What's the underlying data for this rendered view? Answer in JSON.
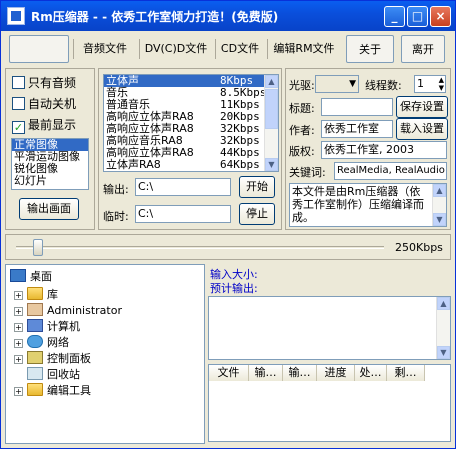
{
  "window": {
    "title": "Rm压缩器 - - 依秀工作室倾力打造！(免费版)",
    "min": "_",
    "max": "□",
    "close": "×"
  },
  "toolbar": {
    "audio": "音频文件",
    "dvd": "DV(C)D文件",
    "cd": "CD文件",
    "edit": "编辑RM文件",
    "about": "关于",
    "exit": "离开"
  },
  "options": {
    "audio_only": "只有音频",
    "auto_shutdown": "自动关机",
    "top_most": "最前显示",
    "top_most_checked": true
  },
  "image_modes": [
    "正常图像",
    "平滑运动图像",
    "锐化图像",
    "幻灯片"
  ],
  "output_screen": "输出画面",
  "formats": [
    {
      "name": "立体声",
      "rate": "8Kbps"
    },
    {
      "name": "音乐",
      "rate": "8.5Kbps"
    },
    {
      "name": "普通音乐",
      "rate": "11Kbps"
    },
    {
      "name": "高响应立体声RA8",
      "rate": "20Kbps"
    },
    {
      "name": "高响应立体声RA8",
      "rate": "32Kbps"
    },
    {
      "name": "高响应音乐RA8",
      "rate": "32Kbps"
    },
    {
      "name": "高响应立体声RA8",
      "rate": "44Kbps"
    },
    {
      "name": "立体声RA8",
      "rate": "64Kbps"
    }
  ],
  "output": {
    "out_label": "输出:",
    "out_value": "C:\\",
    "tmp_label": "临时:",
    "tmp_value": "C:\\",
    "start": "开始",
    "stop": "停止"
  },
  "meta": {
    "drive_label": "光驱:",
    "threads_label": "线程数:",
    "threads_value": "1",
    "title_label": "标题:",
    "title_value": "",
    "save_settings": "保存设置",
    "author_label": "作者:",
    "author_value": "依秀工作室",
    "load_settings": "载入设置",
    "copyright_label": "版权:",
    "copyright_value": "依秀工作室, 2003",
    "keywords_label": "关键词:",
    "keywords_value": "RealMedia, RealAudio",
    "description": "本文件是由Rm压缩器（依秀工作室制作）压缩编译而成。"
  },
  "slider": {
    "value_label": "250Kbps",
    "fraction": 0.06
  },
  "tree": {
    "root": "桌面",
    "items": [
      {
        "label": "库",
        "icon": "folder",
        "expand": true
      },
      {
        "label": "Administrator",
        "icon": "user",
        "expand": true
      },
      {
        "label": "计算机",
        "icon": "pc",
        "expand": true
      },
      {
        "label": "网络",
        "icon": "net",
        "expand": true
      },
      {
        "label": "控制面板",
        "icon": "ctrl",
        "expand": true
      },
      {
        "label": "回收站",
        "icon": "bin",
        "expand": false
      },
      {
        "label": "编辑工具",
        "icon": "folder",
        "expand": true
      }
    ]
  },
  "info": {
    "input_size": "输入大小:",
    "estimated_output": "预计输出:"
  },
  "queue_columns": [
    "文件",
    "输…",
    "输…",
    "进度",
    "处…",
    "剩…"
  ]
}
